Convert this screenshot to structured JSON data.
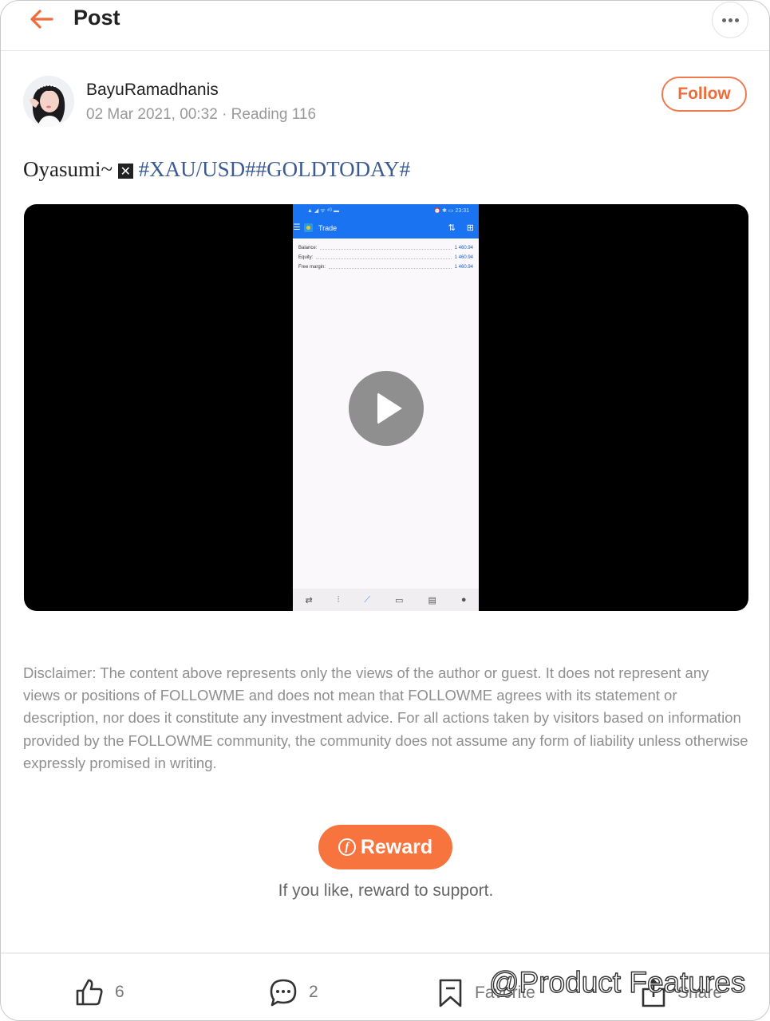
{
  "header": {
    "title": "Post",
    "back_icon": "arrow-left-icon",
    "more_icon": "more-horizontal-icon"
  },
  "post": {
    "author": "BayuRamadhanis",
    "meta": "02 Mar 2021, 00:32 · Reading 116",
    "follow_label": "Follow",
    "text_plain": "Oyasumi~",
    "emoji_placeholder": "✕",
    "hashtags": "#XAU/USD##GOLDTODAY#"
  },
  "video": {
    "play_icon": "play-icon",
    "screen": {
      "status_left": "▲ ◢ ᯤ ⁴ᴳ ▬",
      "status_right": "⏰ ✱ ▭ 23:31",
      "app_title": "Trade",
      "rows": [
        {
          "label": "Balance:",
          "value": "1 460.94"
        },
        {
          "label": "Equity:",
          "value": "1 460.94"
        },
        {
          "label": "Free margin:",
          "value": "1 460.94"
        }
      ],
      "nav_icons": [
        "quotes-icon",
        "chart-icon",
        "trade-icon",
        "history-icon",
        "news-icon",
        "chat-icon"
      ]
    }
  },
  "disclaimer": "Disclaimer: The content above represents only the views of the author or guest. It does not represent any views or positions of FOLLOWME and does not mean that FOLLOWME agrees with its statement or description, nor does it constitute any investment advice. For all actions taken by visitors based on information provided by the FOLLOWME community, the community does not assume any form of liability unless otherwise expressly promised in writing.",
  "reward": {
    "label": "Reward",
    "coin_glyph": "f",
    "hint": "If you like, reward to support."
  },
  "actions": {
    "like_count": "6",
    "comment_count": "2",
    "favorite_label": "Favorite",
    "share_label": "Share"
  },
  "watermark": "@Product Features",
  "colors": {
    "accent": "#ef6d3b",
    "hashtag": "#3b5b94",
    "reward_bg": "#f7743f",
    "app_blue": "#1a73f0"
  }
}
